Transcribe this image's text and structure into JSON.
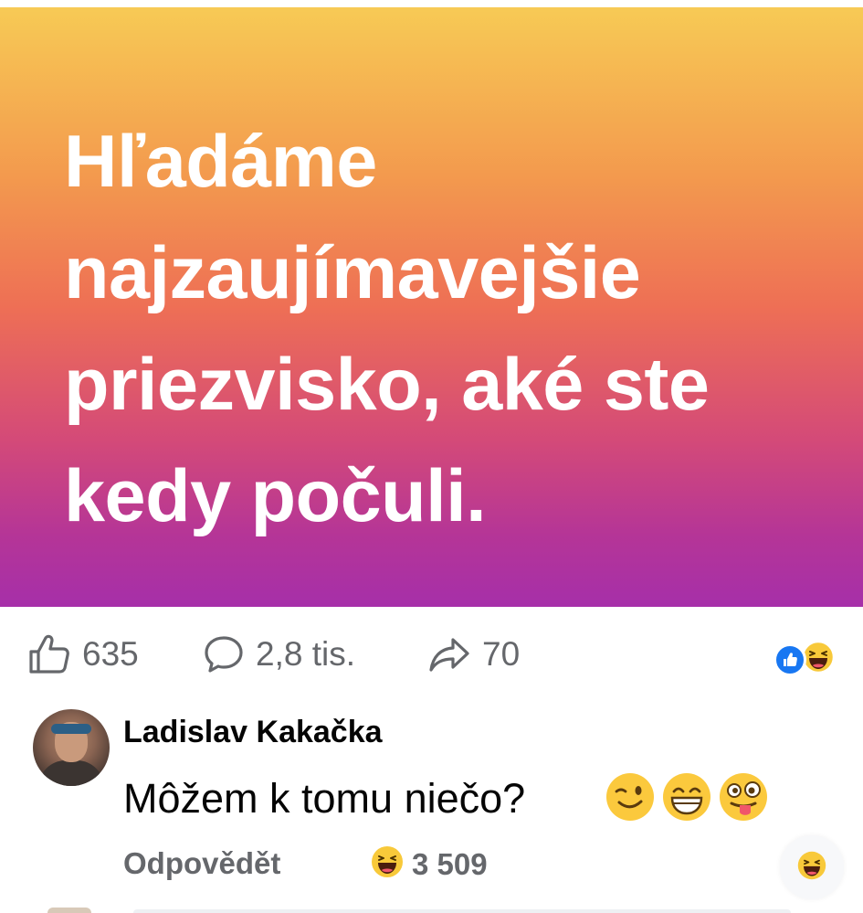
{
  "post": {
    "text": "Hľadáme najzaujímavejšie priezvisko, aké ste kedy počuli.",
    "background_gradient": [
      "#f7ca55",
      "#ee6f55",
      "#a62fa9"
    ],
    "text_color": "#ffffff"
  },
  "stats": {
    "likes": {
      "icon": "thumbs-up-icon",
      "value": "635"
    },
    "comments": {
      "icon": "comment-bubble-icon",
      "value": "2,8 tis."
    },
    "shares": {
      "icon": "share-arrow-icon",
      "value": "70"
    },
    "reaction_badges": [
      "like-reaction-icon",
      "haha-reaction-icon"
    ]
  },
  "comment": {
    "author": "Ladislav Kakačka",
    "text": "Môžem k tomu niečo?",
    "emojis": [
      "winking-face-icon",
      "grinning-squinting-face-icon",
      "zany-face-icon"
    ],
    "reply_label": "Odpovědět",
    "reaction_icon": "haha-reaction-icon",
    "reaction_count": "3 509",
    "react_button_icon": "haha-reaction-icon"
  },
  "colors": {
    "like_blue": "#1877f2",
    "secondary_text": "#65676b",
    "primary_text": "#050505"
  }
}
